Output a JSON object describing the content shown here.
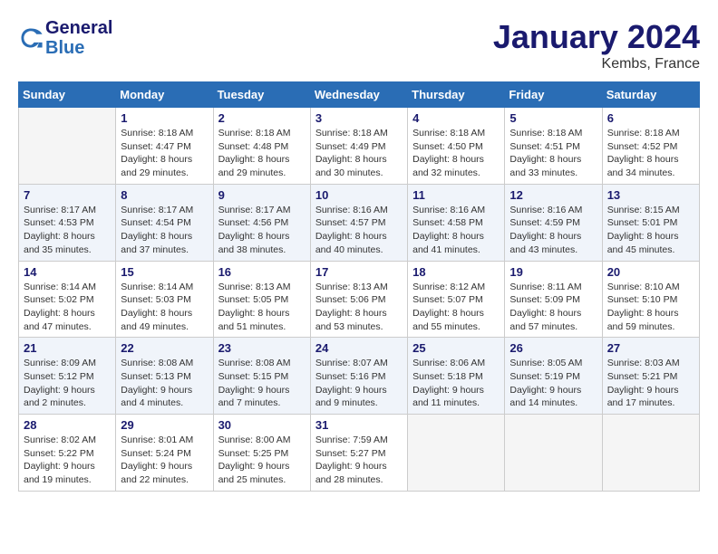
{
  "header": {
    "logo_line1": "General",
    "logo_line2": "Blue",
    "month": "January 2024",
    "location": "Kembs, France"
  },
  "weekdays": [
    "Sunday",
    "Monday",
    "Tuesday",
    "Wednesday",
    "Thursday",
    "Friday",
    "Saturday"
  ],
  "weeks": [
    [
      {
        "day": "",
        "empty": true
      },
      {
        "day": "1",
        "sunrise": "8:18 AM",
        "sunset": "4:47 PM",
        "daylight": "8 hours and 29 minutes."
      },
      {
        "day": "2",
        "sunrise": "8:18 AM",
        "sunset": "4:48 PM",
        "daylight": "8 hours and 29 minutes."
      },
      {
        "day": "3",
        "sunrise": "8:18 AM",
        "sunset": "4:49 PM",
        "daylight": "8 hours and 30 minutes."
      },
      {
        "day": "4",
        "sunrise": "8:18 AM",
        "sunset": "4:50 PM",
        "daylight": "8 hours and 32 minutes."
      },
      {
        "day": "5",
        "sunrise": "8:18 AM",
        "sunset": "4:51 PM",
        "daylight": "8 hours and 33 minutes."
      },
      {
        "day": "6",
        "sunrise": "8:18 AM",
        "sunset": "4:52 PM",
        "daylight": "8 hours and 34 minutes."
      }
    ],
    [
      {
        "day": "7",
        "sunrise": "8:17 AM",
        "sunset": "4:53 PM",
        "daylight": "8 hours and 35 minutes."
      },
      {
        "day": "8",
        "sunrise": "8:17 AM",
        "sunset": "4:54 PM",
        "daylight": "8 hours and 37 minutes."
      },
      {
        "day": "9",
        "sunrise": "8:17 AM",
        "sunset": "4:56 PM",
        "daylight": "8 hours and 38 minutes."
      },
      {
        "day": "10",
        "sunrise": "8:16 AM",
        "sunset": "4:57 PM",
        "daylight": "8 hours and 40 minutes."
      },
      {
        "day": "11",
        "sunrise": "8:16 AM",
        "sunset": "4:58 PM",
        "daylight": "8 hours and 41 minutes."
      },
      {
        "day": "12",
        "sunrise": "8:16 AM",
        "sunset": "4:59 PM",
        "daylight": "8 hours and 43 minutes."
      },
      {
        "day": "13",
        "sunrise": "8:15 AM",
        "sunset": "5:01 PM",
        "daylight": "8 hours and 45 minutes."
      }
    ],
    [
      {
        "day": "14",
        "sunrise": "8:14 AM",
        "sunset": "5:02 PM",
        "daylight": "8 hours and 47 minutes."
      },
      {
        "day": "15",
        "sunrise": "8:14 AM",
        "sunset": "5:03 PM",
        "daylight": "8 hours and 49 minutes."
      },
      {
        "day": "16",
        "sunrise": "8:13 AM",
        "sunset": "5:05 PM",
        "daylight": "8 hours and 51 minutes."
      },
      {
        "day": "17",
        "sunrise": "8:13 AM",
        "sunset": "5:06 PM",
        "daylight": "8 hours and 53 minutes."
      },
      {
        "day": "18",
        "sunrise": "8:12 AM",
        "sunset": "5:07 PM",
        "daylight": "8 hours and 55 minutes."
      },
      {
        "day": "19",
        "sunrise": "8:11 AM",
        "sunset": "5:09 PM",
        "daylight": "8 hours and 57 minutes."
      },
      {
        "day": "20",
        "sunrise": "8:10 AM",
        "sunset": "5:10 PM",
        "daylight": "8 hours and 59 minutes."
      }
    ],
    [
      {
        "day": "21",
        "sunrise": "8:09 AM",
        "sunset": "5:12 PM",
        "daylight": "9 hours and 2 minutes."
      },
      {
        "day": "22",
        "sunrise": "8:08 AM",
        "sunset": "5:13 PM",
        "daylight": "9 hours and 4 minutes."
      },
      {
        "day": "23",
        "sunrise": "8:08 AM",
        "sunset": "5:15 PM",
        "daylight": "9 hours and 7 minutes."
      },
      {
        "day": "24",
        "sunrise": "8:07 AM",
        "sunset": "5:16 PM",
        "daylight": "9 hours and 9 minutes."
      },
      {
        "day": "25",
        "sunrise": "8:06 AM",
        "sunset": "5:18 PM",
        "daylight": "9 hours and 11 minutes."
      },
      {
        "day": "26",
        "sunrise": "8:05 AM",
        "sunset": "5:19 PM",
        "daylight": "9 hours and 14 minutes."
      },
      {
        "day": "27",
        "sunrise": "8:03 AM",
        "sunset": "5:21 PM",
        "daylight": "9 hours and 17 minutes."
      }
    ],
    [
      {
        "day": "28",
        "sunrise": "8:02 AM",
        "sunset": "5:22 PM",
        "daylight": "9 hours and 19 minutes."
      },
      {
        "day": "29",
        "sunrise": "8:01 AM",
        "sunset": "5:24 PM",
        "daylight": "9 hours and 22 minutes."
      },
      {
        "day": "30",
        "sunrise": "8:00 AM",
        "sunset": "5:25 PM",
        "daylight": "9 hours and 25 minutes."
      },
      {
        "day": "31",
        "sunrise": "7:59 AM",
        "sunset": "5:27 PM",
        "daylight": "9 hours and 28 minutes."
      },
      {
        "day": "",
        "empty": true
      },
      {
        "day": "",
        "empty": true
      },
      {
        "day": "",
        "empty": true
      }
    ]
  ]
}
